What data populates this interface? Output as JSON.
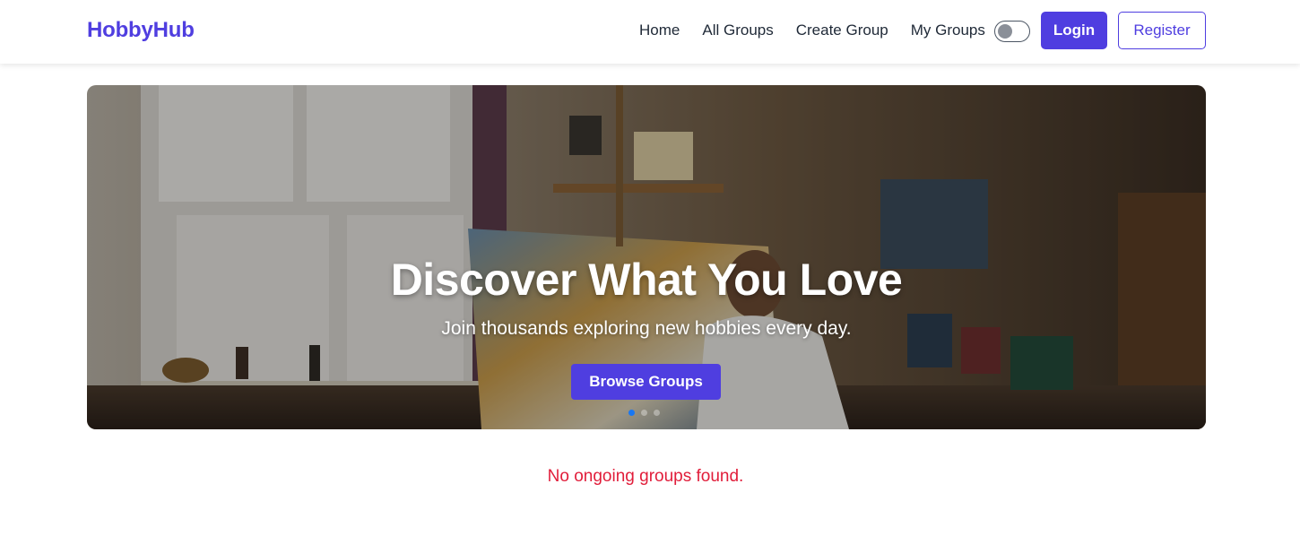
{
  "brand": {
    "name": "HobbyHub",
    "color": "#4f3ee0"
  },
  "nav": {
    "links": [
      "Home",
      "All Groups",
      "Create Group",
      "My Groups"
    ],
    "theme_toggle_state": "off",
    "login_label": "Login",
    "register_label": "Register"
  },
  "hero": {
    "title": "Discover What You Love",
    "subtitle": "Join thousands exploring new hobbies every day.",
    "cta_label": "Browse Groups",
    "slides_count": 3,
    "active_slide": 1
  },
  "groups": {
    "empty_message": "No ongoing groups found."
  },
  "colors": {
    "accent": "#4f3ee0",
    "error": "#e11d3a",
    "carousel_active": "#1877f2"
  }
}
